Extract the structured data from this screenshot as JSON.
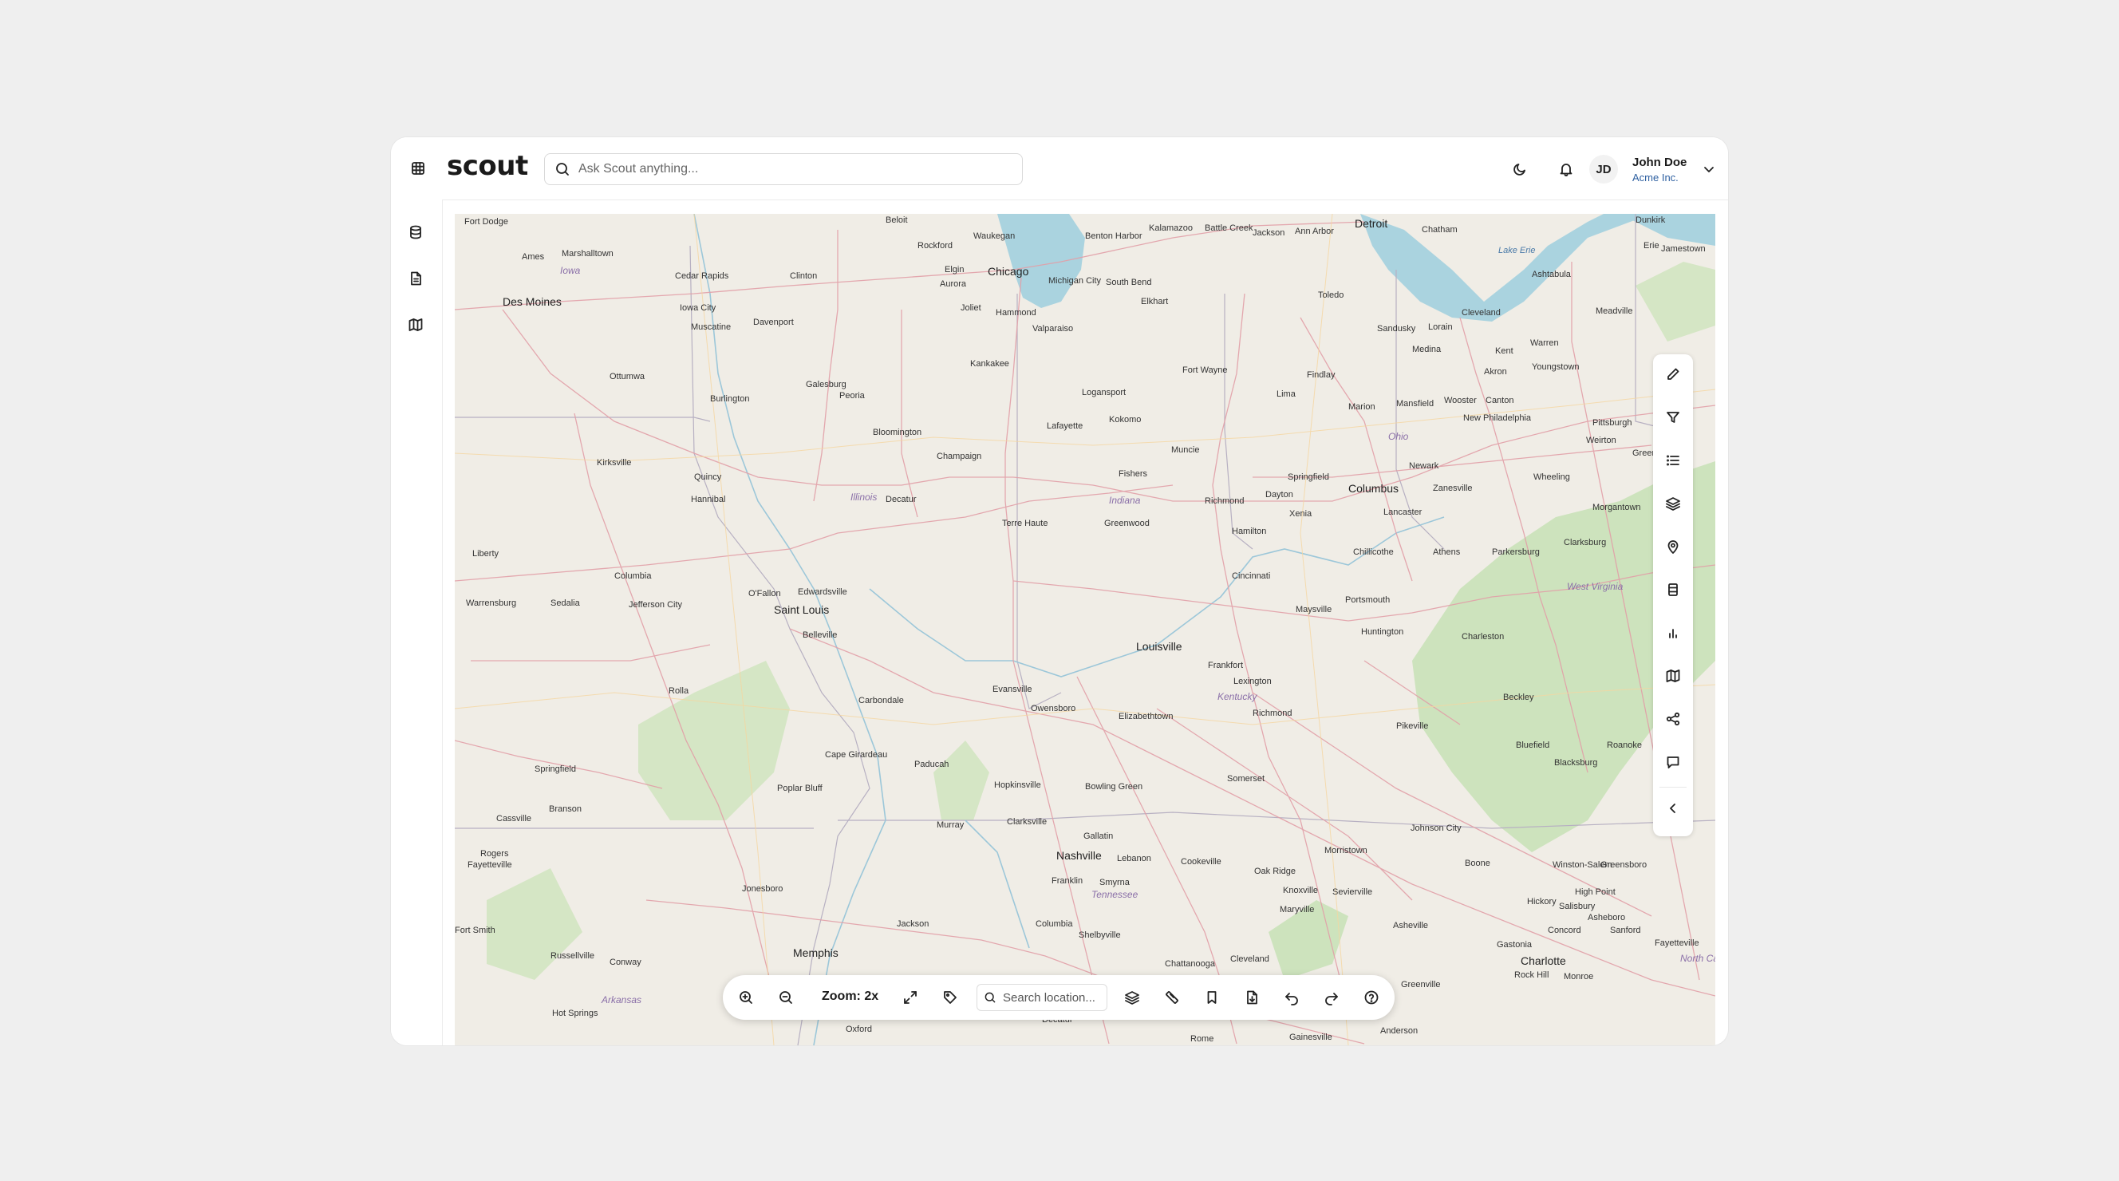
{
  "app": {
    "logo": "scout"
  },
  "header": {
    "search_placeholder": "Ask Scout anything...",
    "user": {
      "initials": "JD",
      "name": "John Doe",
      "org": "Acme Inc."
    }
  },
  "map": {
    "zoom_label": "Zoom: 2x",
    "search_placeholder": "Search location...",
    "cities": [
      "Fort Dodge",
      "Beloit",
      "Waukegan",
      "Benton Harbor",
      "Kalamazoo",
      "Battle Creek",
      "Jackson",
      "Ann Arbor",
      "Detroit",
      "Chatham",
      "Dunkirk",
      "Ames",
      "Marshalltown",
      "Rockford",
      "Elgin",
      "Aurora",
      "Chicago",
      "Michigan City",
      "South Bend",
      "Elkhart",
      "Erie",
      "Jamestown",
      "Cedar Rapids",
      "Clinton",
      "Joliet",
      "Hammond",
      "Valparaiso",
      "Toledo",
      "Sandusky",
      "Lorain",
      "Cleveland",
      "Ashtabula",
      "Meadville",
      "Des Moines",
      "Iowa City",
      "Davenport",
      "Muscatine",
      "Kankakee",
      "Fort Wayne",
      "Findlay",
      "Medina",
      "Akron",
      "Kent",
      "Warren",
      "Youngstown",
      "Ottumwa",
      "Galesburg",
      "Peoria",
      "Logansport",
      "Lima",
      "Marion",
      "Mansfield",
      "Wooster",
      "Canton",
      "Burlington",
      "Bloomington",
      "Kokomo",
      "New Philadelphia",
      "Weirton",
      "Pittsburgh",
      "Lafayette",
      "Champaign",
      "Muncie",
      "Greensburg",
      "Kirksville",
      "Quincy",
      "Fishers",
      "Newark",
      "Wheeling",
      "Hannibal",
      "Decatur",
      "Springfield",
      "Zanesville",
      "Dayton",
      "Richmond",
      "Columbus",
      "Xenia",
      "Lancaster",
      "Morgantown",
      "Terre Haute",
      "Greenwood",
      "Hamilton",
      "Chillicothe",
      "Athens",
      "Parkersburg",
      "Clarksburg",
      "Liberty",
      "Columbia",
      "Cincinnati",
      "Edwardsville",
      "O'Fallon",
      "Saint Louis",
      "Sedalia",
      "Warrensburg",
      "Jefferson City",
      "Belleville",
      "Portsmouth",
      "Maysville",
      "Huntington",
      "Charleston",
      "Louisville",
      "Frankfort",
      "Lexington",
      "Richmond",
      "Carbondale",
      "Evansville",
      "Owensboro",
      "Elizabethtown",
      "Rolla",
      "Beckley",
      "Pikeville",
      "Bluefield",
      "Blacksburg",
      "Roanoke",
      "Cape Girardeau",
      "Paducah",
      "Somerset",
      "Springfield",
      "Poplar Bluff",
      "Hopkinsville",
      "Bowling Green",
      "Cassville",
      "Branson",
      "Clarksville",
      "Gallatin",
      "Johnson City",
      "Murray",
      "Nashville",
      "Lebanon",
      "Cookeville",
      "Morristown",
      "Boone",
      "Winston-Salem",
      "Greensboro",
      "Rogers",
      "Fayetteville",
      "Jonesboro",
      "Franklin",
      "Smyrna",
      "Oak Ridge",
      "Knoxville",
      "Sevierville",
      "Hickory",
      "Salisbury",
      "High Point",
      "Maryville",
      "Asheville",
      "Asheboro",
      "Jackson",
      "Columbia",
      "Shelbyville",
      "Concord",
      "Sanford",
      "Fort Smith",
      "Russellville",
      "Conway",
      "Memphis",
      "Chattanooga",
      "Cleveland",
      "Greenville",
      "Gastonia",
      "Charlotte",
      "Rock Hill",
      "Monroe",
      "Hot Springs",
      "Oxford",
      "Decatur",
      "Rome",
      "Gainesville",
      "Anderson",
      "Fayetteville"
    ],
    "regions": [
      "Iowa",
      "Illinois",
      "Indiana",
      "Ohio",
      "West Virginia",
      "Kentucky",
      "Tennessee",
      "Arkansas",
      "North Ca"
    ],
    "water": [
      "Lake Erie"
    ]
  },
  "colors": {
    "accent": "#2d5fa0",
    "map_bg": "#f0ede6",
    "water": "#aad3df",
    "forest": "#cde3bd",
    "road": "#e2a0a8"
  }
}
